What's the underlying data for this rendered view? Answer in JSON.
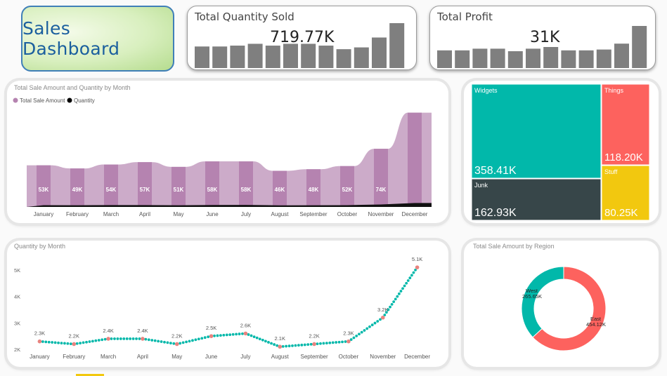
{
  "dashboard": {
    "title": "Sales Dashboard"
  },
  "kpi_quantity": {
    "label": "Total Quantity Sold",
    "value": "719.77K",
    "bars": [
      0.48,
      0.48,
      0.5,
      0.54,
      0.5,
      0.54,
      0.54,
      0.5,
      0.42,
      0.46,
      0.68,
      1.0
    ]
  },
  "kpi_profit": {
    "label": "Total Profit",
    "value": "31K",
    "bars": [
      0.42,
      0.42,
      0.46,
      0.46,
      0.4,
      0.46,
      0.5,
      0.42,
      0.42,
      0.44,
      0.58,
      1.0
    ]
  },
  "colors": {
    "accent_purple": "#b583b0",
    "purple_light": "#c9a6c6",
    "teal": "#01b8aa",
    "red": "#fd625e",
    "yellow": "#f2c80f",
    "dark": "#374649",
    "line_marker": "#e8837f"
  },
  "combo": {
    "title": "Total Sale Amount and Quantity by Month",
    "legend": [
      {
        "label": "Total Sale Amount",
        "color": "#b583b0"
      },
      {
        "label": "Quantity",
        "color": "#000000"
      }
    ]
  },
  "treemap": {
    "items": [
      {
        "name": "Widgets",
        "value": "358.41K",
        "color": "#01b8aa"
      },
      {
        "name": "Things",
        "value": "118.20K",
        "color": "#fd625e"
      },
      {
        "name": "Junk",
        "value": "162.93K",
        "color": "#374649"
      },
      {
        "name": "Stuff",
        "value": "80.25K",
        "color": "#f2c80f"
      }
    ]
  },
  "line_panel": {
    "title": "Quantity by Month",
    "yticks": [
      "5K",
      "4K",
      "3K",
      "2K"
    ]
  },
  "donut_panel": {
    "title": "Total Sale Amount by Region",
    "slices": [
      {
        "name": "West",
        "value": "265.65K",
        "color": "#01b8aa"
      },
      {
        "name": "East",
        "value": "454.12K",
        "color": "#fd625e"
      }
    ]
  },
  "chart_data": [
    {
      "type": "bar",
      "title": "Total Sale Amount and Quantity by Month",
      "categories": [
        "January",
        "February",
        "March",
        "April",
        "May",
        "June",
        "July",
        "August",
        "September",
        "October",
        "November",
        "December"
      ],
      "series": [
        {
          "name": "Total Sale Amount",
          "values": [
            53,
            49,
            54,
            57,
            51,
            58,
            58,
            46,
            48,
            52,
            74,
            120
          ],
          "labels": [
            "53K",
            "49K",
            "54K",
            "57K",
            "51K",
            "58K",
            "58K",
            "46K",
            "48K",
            "52K",
            "74K",
            ""
          ]
        },
        {
          "name": "Quantity",
          "values": [
            2.3,
            2.2,
            2.4,
            2.4,
            2.2,
            2.5,
            2.6,
            2.1,
            2.2,
            2.3,
            3.2,
            5.1
          ]
        }
      ],
      "legend": "top-left"
    },
    {
      "type": "line",
      "title": "Quantity by Month",
      "categories": [
        "January",
        "February",
        "March",
        "April",
        "May",
        "June",
        "July",
        "August",
        "September",
        "October",
        "November",
        "December"
      ],
      "values": [
        2.3,
        2.2,
        2.4,
        2.4,
        2.2,
        2.5,
        2.6,
        2.1,
        2.2,
        2.3,
        3.2,
        5.1
      ],
      "labels": [
        "2.3K",
        "2.2K",
        "2.4K",
        "2.4K",
        "2.2K",
        "2.5K",
        "2.6K",
        "2.1K",
        "2.2K",
        "2.3K",
        "3.2K",
        "5.1K"
      ],
      "ylim": [
        2,
        5.3
      ]
    },
    {
      "type": "pie",
      "title": "Total Sale Amount by Region",
      "categories": [
        "West",
        "East"
      ],
      "values": [
        265.65,
        454.12
      ]
    }
  ]
}
